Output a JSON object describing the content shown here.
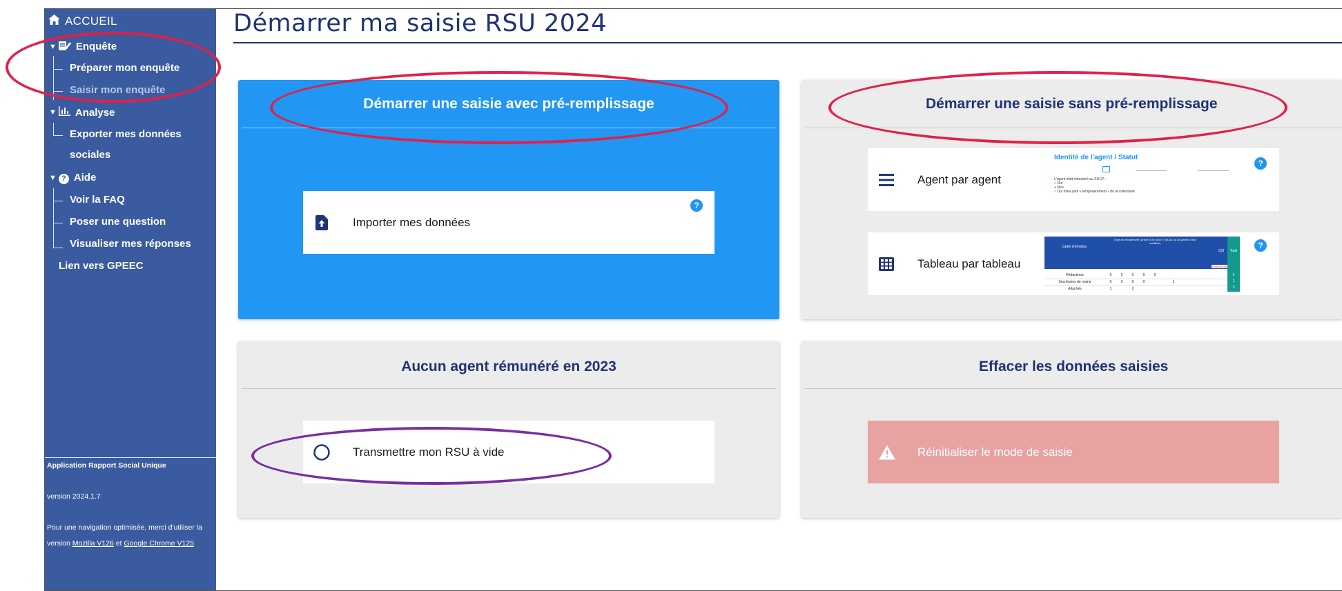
{
  "sidebar": {
    "home": "ACCUEIL",
    "groups": [
      {
        "label": "Enquête",
        "items": [
          "Préparer mon enquête",
          "Saisir mon enquête"
        ]
      },
      {
        "label": "Analyse",
        "items": [
          "Exporter mes données",
          "sociales"
        ]
      },
      {
        "label": "Aide",
        "items": [
          "Voir la FAQ",
          "Poser une question",
          "Visualiser mes réponses"
        ]
      }
    ],
    "gpeec_link": "Lien vers GPEEC",
    "footer": {
      "app_name": "Application Rapport Social Unique",
      "version": "version 2024.1.7",
      "nav_note_1": "Pour une navigation optimisée, merci d'utiliser la",
      "nav_note_2_prefix": "version ",
      "browser_1": "Mozilla V126",
      "nav_note_2_mid": " et ",
      "browser_2": "Google Chrome V125"
    }
  },
  "page": {
    "title": "Démarrer ma saisie RSU 2024"
  },
  "cards": {
    "prefill": {
      "title": "Démarrer une saisie avec pré-remplissage",
      "import_label": "Importer mes données",
      "help": "?"
    },
    "no_prefill": {
      "title": "Démarrer une saisie sans pré-remplissage",
      "agent_label": "Agent par agent",
      "table_label": "Tableau par tableau",
      "help": "?",
      "agent_thumb": {
        "title": "Identité de l'agent / Statut",
        "line1": "L'agent était rémunéré au 31/12* :",
        "opt1": "Oui",
        "opt2": "Non",
        "opt3": "Oui mais parti « temporairement » de la collectivité"
      },
      "table_thumb": {
        "col_header": "Cadre d'emplois",
        "group_header": "Type de recrutement (Article 3 de la loi n° 84-53 du 26 janvier 1984 modifiée)",
        "cdi": "CDI",
        "total": "Total",
        "section": "Administrati",
        "rows": [
          {
            "label": "Rédacteurs",
            "vals": [
              "0",
              "2",
              "0",
              "0",
              "0"
            ],
            "total": "2"
          },
          {
            "label": "Secrétaires de mairie",
            "vals": [
              "0",
              "0",
              "0",
              "0",
              "1"
            ],
            "total": "1"
          },
          {
            "label": "Attachés",
            "vals": [
              "1",
              "",
              "2",
              "",
              ""
            ],
            "total": "3"
          }
        ]
      }
    },
    "no_agent": {
      "title": "Aucun agent rémunéré en 2023",
      "empty_label": "Transmettre mon RSU à vide"
    },
    "reset": {
      "title": "Effacer les données saisies",
      "reset_label": "Réinitialiser le mode de saisie"
    }
  },
  "colors": {
    "sidebar": "#3a5ba0",
    "title": "#1f3377",
    "primary": "#2196f3",
    "danger": "#e8a2a2",
    "annotation_red": "#e0214a",
    "annotation_purple": "#7a2ea0"
  }
}
